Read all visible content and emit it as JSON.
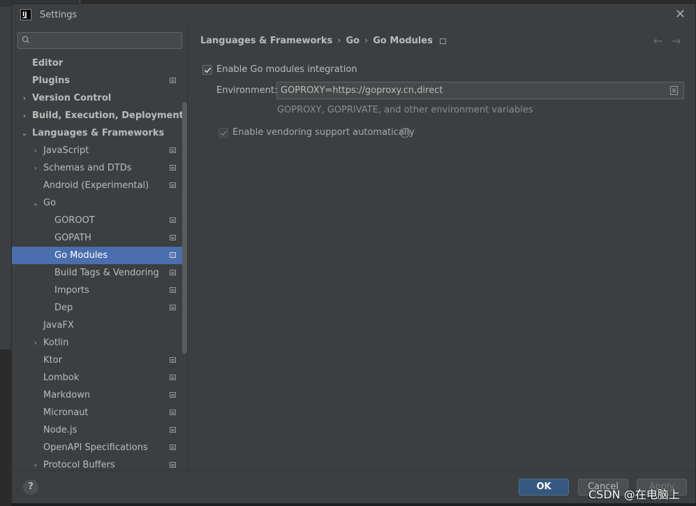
{
  "window": {
    "title": "Settings",
    "app_icon_text": "IJ"
  },
  "search": {
    "placeholder": "",
    "value": ""
  },
  "sidebar": {
    "items": [
      {
        "label": "Editor"
      },
      {
        "label": "Plugins"
      },
      {
        "label": "Version Control"
      },
      {
        "label": "Build, Execution, Deployment"
      },
      {
        "label": "Languages & Frameworks"
      },
      {
        "label": "JavaScript"
      },
      {
        "label": "Schemas and DTDs"
      },
      {
        "label": "Android (Experimental)"
      },
      {
        "label": "Go"
      },
      {
        "label": "GOROOT"
      },
      {
        "label": "GOPATH"
      },
      {
        "label": "Go Modules"
      },
      {
        "label": "Build Tags & Vendoring"
      },
      {
        "label": "Imports"
      },
      {
        "label": "Dep"
      },
      {
        "label": "JavaFX"
      },
      {
        "label": "Kotlin"
      },
      {
        "label": "Ktor"
      },
      {
        "label": "Lombok"
      },
      {
        "label": "Markdown"
      },
      {
        "label": "Micronaut"
      },
      {
        "label": "Node.js"
      },
      {
        "label": "OpenAPI Specifications"
      },
      {
        "label": "Protocol Buffers"
      }
    ]
  },
  "breadcrumb": {
    "items": [
      "Languages & Frameworks",
      "Go",
      "Go Modules"
    ]
  },
  "go_modules": {
    "enable_integration": {
      "label": "Enable Go modules integration",
      "checked": true
    },
    "environment": {
      "label": "Environment:",
      "value": "GOPROXY=https://goproxy.cn,direct",
      "hint": "GOPROXY, GOPRIVATE, and other environment variables"
    },
    "vendoring": {
      "label": "Enable vendoring support automatically",
      "checked": true,
      "enabled": false
    }
  },
  "footer": {
    "help_label": "?",
    "ok_label": "OK",
    "cancel_label": "Cancel",
    "apply_label": "Apply"
  },
  "watermark": "CSDN @在电脑上",
  "colors": {
    "selection": "#4b6eaf",
    "ok_button": "#365880",
    "background": "#3c3f41"
  }
}
